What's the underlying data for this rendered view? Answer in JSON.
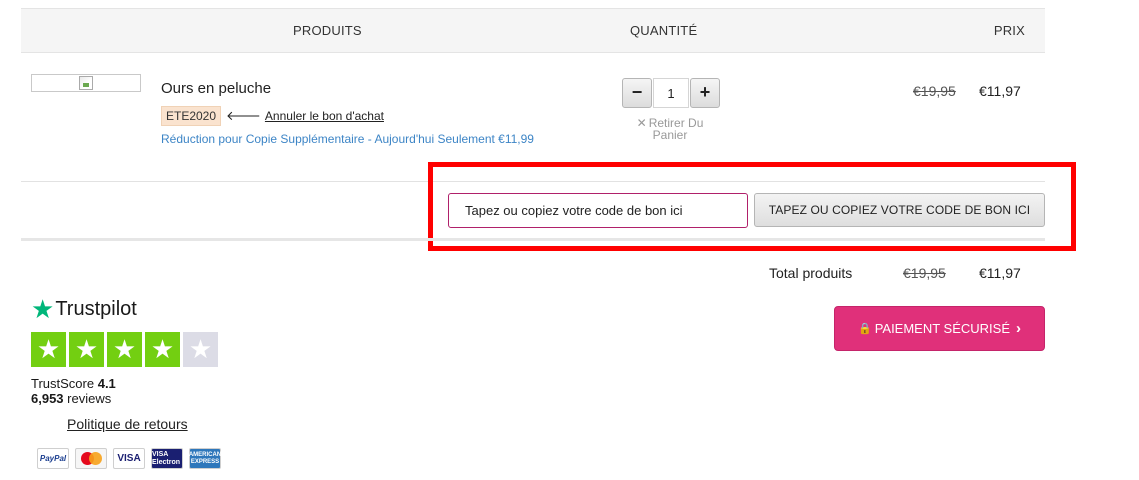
{
  "table_header": {
    "produits": "PRODUITS",
    "quantite": "QUANTITÉ",
    "prix": "PRIX"
  },
  "product": {
    "name": "Ours en peluche",
    "coupon_code": "ETE2020",
    "undo_link": "Annuler le bon d'achat",
    "discount_text": "Réduction pour Copie Supplémentaire - Aujourd'hui Seulement €11,99",
    "quantity": "1",
    "decrement_label": "−",
    "increment_label": "+",
    "remove_label": "Retirer Du Panier",
    "price_old": "€19,95",
    "price_new": "€11,97"
  },
  "coupon": {
    "input_value": "Tapez ou copiez votre code de bon ici",
    "button_label": "TAPEZ OU COPIEZ VOTRE CODE DE BON ICI"
  },
  "totals": {
    "label": "Total produits",
    "old": "€19,95",
    "new": "€11,97"
  },
  "checkout": {
    "button_label": "PAIEMENT SÉCURISÉ"
  },
  "trustpilot": {
    "brand": "Trustpilot",
    "rating_stars": 4,
    "max_stars": 5,
    "score_label": "TrustScore",
    "score_value": "4.1",
    "reviews_count": "6,953",
    "reviews_label": "reviews"
  },
  "returns_link": "Politique de retours",
  "payment_cards": [
    {
      "name": "paypal",
      "label": "PayPal"
    },
    {
      "name": "mastercard",
      "label": ""
    },
    {
      "name": "visa",
      "label": "VISA"
    },
    {
      "name": "visa-electron",
      "label": "VISA Electron"
    },
    {
      "name": "american-express",
      "label": "AMERICAN EXPRESS"
    }
  ],
  "colors": {
    "accent_pink": "#e0307a",
    "highlight_red": "#ff0000",
    "trustpilot_green": "#00b67a",
    "star_green": "#73cf11",
    "discount_blue": "#3d85c6",
    "coupon_badge": "#fae3cf"
  }
}
